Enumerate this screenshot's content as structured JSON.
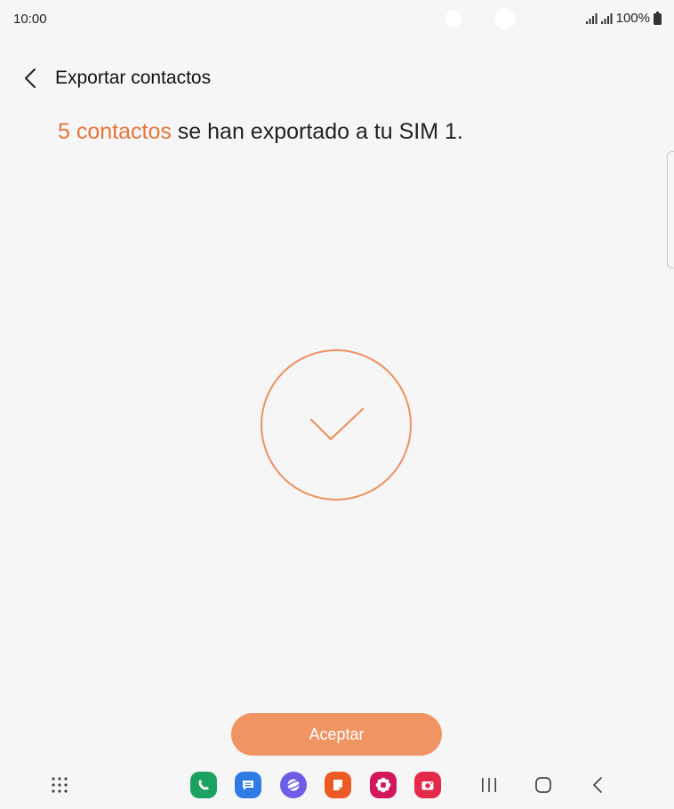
{
  "status_bar": {
    "time": "10:00",
    "battery": "100%",
    "icons": [
      "signal-sim1-icon",
      "signal-sim2-icon",
      "battery-icon"
    ]
  },
  "header": {
    "title": "Exportar contactos",
    "back_icon": "back-arrow-icon"
  },
  "message": {
    "highlight": "5 contactos",
    "rest": " se han exportado a tu SIM 1."
  },
  "success_icon": "checkmark-circle-icon",
  "accept_button": {
    "label": "Aceptar"
  },
  "navigation": {
    "apps": [
      {
        "name": "phone-app-icon",
        "color": "#1aa261"
      },
      {
        "name": "messages-app-icon",
        "color": "#2f7ae5"
      },
      {
        "name": "internet-app-icon",
        "color": "#6c5ce7"
      },
      {
        "name": "notes-app-icon",
        "color": "#ee5a24"
      },
      {
        "name": "gallery-app-icon",
        "color": "#d2185c"
      },
      {
        "name": "camera-app-icon",
        "color": "#e5294b"
      }
    ],
    "system": [
      "apps-grid-icon",
      "recents-icon",
      "home-icon",
      "back-nav-icon"
    ]
  },
  "colors": {
    "accent": "#e8743b",
    "button": "#f09463",
    "background": "#f6f6f6"
  }
}
